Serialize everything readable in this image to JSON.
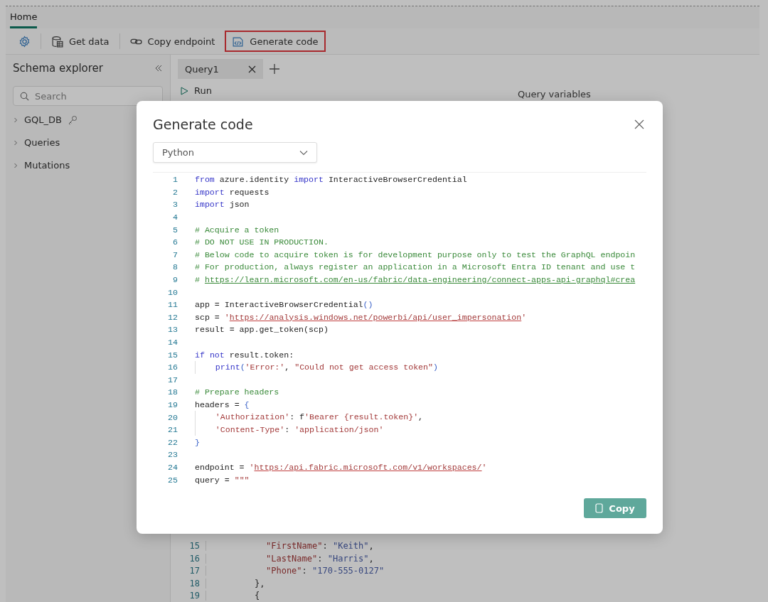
{
  "ribbon_tabs": [
    {
      "label": "Home",
      "selected": true
    }
  ],
  "toolbar": [
    {
      "kind": "settings",
      "highlighted": false,
      "divider_after": true
    },
    {
      "kind": "get-data",
      "label": "Get data",
      "highlighted": false,
      "divider_after": true
    },
    {
      "kind": "copy-endpoint",
      "label": "Copy endpoint",
      "highlighted": false,
      "divider_after": false
    },
    {
      "kind": "generate-code",
      "label": "Generate code",
      "highlighted": true,
      "divider_after": false
    }
  ],
  "schema_explorer": {
    "title": "Schema explorer",
    "search": {
      "placeholder": "Search"
    },
    "items": [
      {
        "label": "GQL_DB",
        "expanded": false,
        "kind": "database"
      },
      {
        "label": "Queries",
        "expanded": false,
        "kind": "folder"
      },
      {
        "label": "Mutations",
        "expanded": false,
        "kind": "folder"
      }
    ]
  },
  "query_tabs": [
    {
      "label": "Query1",
      "selected": true
    }
  ],
  "run_button": {
    "label": "Run"
  },
  "variables_heading": "Query variables",
  "background_code": [
    {
      "number": "15",
      "kind": "property",
      "tokens": [
        {
          "kind": "key",
          "text": "\"FirstName\""
        },
        {
          "kind": "plain",
          "text": ": "
        },
        {
          "kind": "value",
          "text": "\"Keith\""
        },
        {
          "kind": "plain",
          "text": ","
        }
      ]
    },
    {
      "number": "16",
      "kind": "property",
      "tokens": [
        {
          "kind": "key",
          "text": "\"LastName\""
        },
        {
          "kind": "plain",
          "text": ": "
        },
        {
          "kind": "value",
          "text": "\"Harris\""
        },
        {
          "kind": "plain",
          "text": ","
        }
      ]
    },
    {
      "number": "17",
      "kind": "property",
      "tokens": [
        {
          "kind": "key",
          "text": "\"Phone\""
        },
        {
          "kind": "plain",
          "text": ": "
        },
        {
          "kind": "value",
          "text": "\"170-555-0127\""
        }
      ]
    },
    {
      "number": "18",
      "kind": "brace",
      "tokens": [
        {
          "kind": "plain",
          "text": "},"
        }
      ]
    },
    {
      "number": "19",
      "kind": "brace",
      "tokens": [
        {
          "kind": "plain",
          "text": "{"
        }
      ]
    }
  ],
  "dialog": {
    "title": "Generate code",
    "language": {
      "value": "Python"
    },
    "code": [
      {
        "number": "1",
        "indented": false,
        "tokens": [
          {
            "kind": "keyword",
            "text": "from"
          },
          {
            "kind": "plain",
            "text": " azure.identity "
          },
          {
            "kind": "keyword",
            "text": "import"
          },
          {
            "kind": "plain",
            "text": " InteractiveBrowserCredential"
          }
        ]
      },
      {
        "number": "2",
        "indented": false,
        "tokens": [
          {
            "kind": "keyword",
            "text": "import"
          },
          {
            "kind": "plain",
            "text": " requests"
          }
        ]
      },
      {
        "number": "3",
        "indented": false,
        "tokens": [
          {
            "kind": "keyword",
            "text": "import"
          },
          {
            "kind": "plain",
            "text": " json"
          }
        ]
      },
      {
        "number": "4",
        "indented": false
      },
      {
        "number": "5",
        "indented": false,
        "tokens": [
          {
            "kind": "comment",
            "text": "# Acquire a token"
          }
        ]
      },
      {
        "number": "6",
        "indented": false,
        "tokens": [
          {
            "kind": "comment",
            "text": "# DO NOT USE IN PRODUCTION."
          }
        ]
      },
      {
        "number": "7",
        "indented": false,
        "tokens": [
          {
            "kind": "comment",
            "text": "# Below code to acquire token is for development purpose only to test the GraphQL endpoin"
          }
        ]
      },
      {
        "number": "8",
        "indented": false,
        "tokens": [
          {
            "kind": "comment",
            "text": "# For production, always register an application in a Microsoft Entra ID tenant and use t"
          }
        ]
      },
      {
        "number": "9",
        "indented": false,
        "tokens": [
          {
            "kind": "comment",
            "text": "# "
          },
          {
            "kind": "comment-link",
            "text": "https://learn.microsoft.com/en-us/fabric/data-engineering/connect-apps-api-graphql#crea"
          }
        ]
      },
      {
        "number": "10",
        "indented": false
      },
      {
        "number": "11",
        "indented": false,
        "tokens": [
          {
            "kind": "plain",
            "text": "app = InteractiveBrowserCredential"
          },
          {
            "kind": "bracket",
            "text": "()"
          }
        ]
      },
      {
        "number": "12",
        "indented": false,
        "tokens": [
          {
            "kind": "plain",
            "text": "scp = "
          },
          {
            "kind": "string",
            "text": "'"
          },
          {
            "kind": "string-link",
            "text": "https://analysis.windows.net/powerbi/api/user_impersonation"
          },
          {
            "kind": "string",
            "text": "'"
          }
        ]
      },
      {
        "number": "13",
        "indented": false,
        "tokens": [
          {
            "kind": "plain",
            "text": "result = app.get_token(scp)"
          }
        ]
      },
      {
        "number": "14",
        "indented": false
      },
      {
        "number": "15",
        "indented": false,
        "tokens": [
          {
            "kind": "keyword",
            "text": "if"
          },
          {
            "kind": "keyword",
            "text": " not"
          },
          {
            "kind": "plain",
            "text": " result.token:"
          }
        ]
      },
      {
        "number": "16",
        "indented": true,
        "tokens": [
          {
            "kind": "keyword",
            "text": "print"
          },
          {
            "kind": "bracket",
            "text": "("
          },
          {
            "kind": "string",
            "text": "'Error:'"
          },
          {
            "kind": "plain",
            "text": ", "
          },
          {
            "kind": "string",
            "text": "\"Could not get access token\""
          },
          {
            "kind": "bracket",
            "text": ")"
          }
        ]
      },
      {
        "number": "17",
        "indented": false
      },
      {
        "number": "18",
        "indented": false,
        "tokens": [
          {
            "kind": "comment",
            "text": "# Prepare headers"
          }
        ]
      },
      {
        "number": "19",
        "indented": false,
        "tokens": [
          {
            "kind": "plain",
            "text": "headers = "
          },
          {
            "kind": "bracket",
            "text": "{"
          }
        ]
      },
      {
        "number": "20",
        "indented": true,
        "tokens": [
          {
            "kind": "string",
            "text": "'Authorization'"
          },
          {
            "kind": "plain",
            "text": ": f"
          },
          {
            "kind": "string",
            "text": "'Bearer {result.token}'"
          },
          {
            "kind": "plain",
            "text": ","
          }
        ]
      },
      {
        "number": "21",
        "indented": true,
        "tokens": [
          {
            "kind": "string",
            "text": "'Content-Type'"
          },
          {
            "kind": "plain",
            "text": ": "
          },
          {
            "kind": "string",
            "text": "'application/json'"
          }
        ]
      },
      {
        "number": "22",
        "indented": false,
        "tokens": [
          {
            "kind": "bracket",
            "text": "}"
          }
        ]
      },
      {
        "number": "23",
        "indented": false
      },
      {
        "number": "24",
        "indented": false,
        "tokens": [
          {
            "kind": "plain",
            "text": "endpoint = "
          },
          {
            "kind": "string",
            "text": "'"
          },
          {
            "kind": "string-link",
            "text": "https:/api.fabric.microsoft.com/v1/workspaces/"
          },
          {
            "kind": "string",
            "text": "'"
          }
        ]
      },
      {
        "number": "25",
        "indented": false,
        "tokens": [
          {
            "kind": "plain",
            "text": "query = "
          },
          {
            "kind": "string",
            "text": "\"\"\""
          }
        ]
      }
    ],
    "copy_button": {
      "label": "Copy"
    }
  }
}
